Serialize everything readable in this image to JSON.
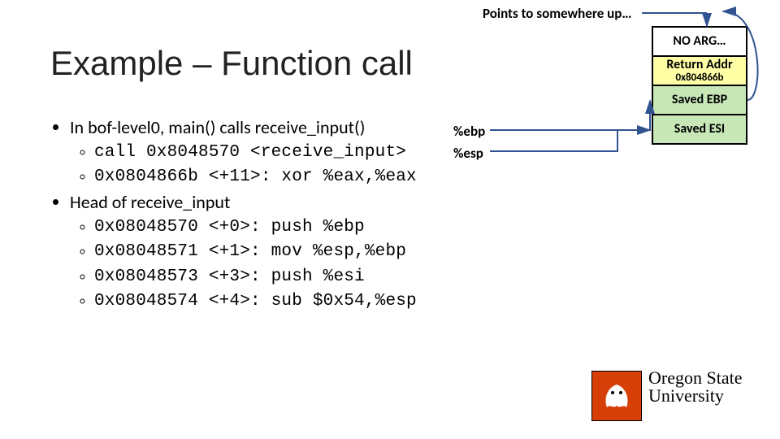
{
  "topNote": "Points to somewhere up…",
  "title": "Example – Function call",
  "bullets": {
    "p1": "In bof-level0, main() calls receive_input()",
    "p1a": "call   0x8048570 <receive_input>",
    "p1b": "0x0804866b <+11>:    xor    %eax,%eax",
    "p2": "Head of receive_input",
    "p2a": "0x08048570 <+0>: push   %ebp",
    "p2b": "0x08048571 <+1>: mov    %esp,%ebp",
    "p2c": "0x08048573 <+3>: push   %esi",
    "p2d": "0x08048574 <+4>: sub    $0x54,%esp"
  },
  "pointers": {
    "ebp": "%ebp",
    "esp": "%esp"
  },
  "stack": {
    "noarg": "NO ARG…",
    "ret1": "Return Addr",
    "ret2": "0x804866b",
    "ebp": "Saved EBP",
    "esi": "Saved ESI"
  },
  "logo": {
    "line1": "Oregon State",
    "line2": "University"
  }
}
